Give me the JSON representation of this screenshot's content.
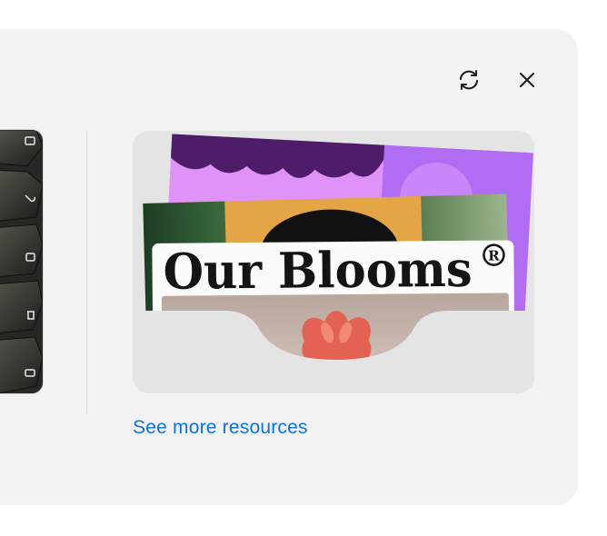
{
  "header": {
    "refresh_icon": "refresh-icon",
    "close_icon": "close-icon"
  },
  "resource": {
    "title": "Our Blooms",
    "registered_mark": "R"
  },
  "footer": {
    "see_more_label": "See more resources"
  },
  "colors": {
    "panel_background": "#f2f2f2",
    "link": "#0d72e0",
    "card_background": "#e4e4e4",
    "purple_back_card": "#df92f7",
    "dark_purple": "#4e1c68",
    "mustard": "#e3a545",
    "flower": "#e46253"
  }
}
